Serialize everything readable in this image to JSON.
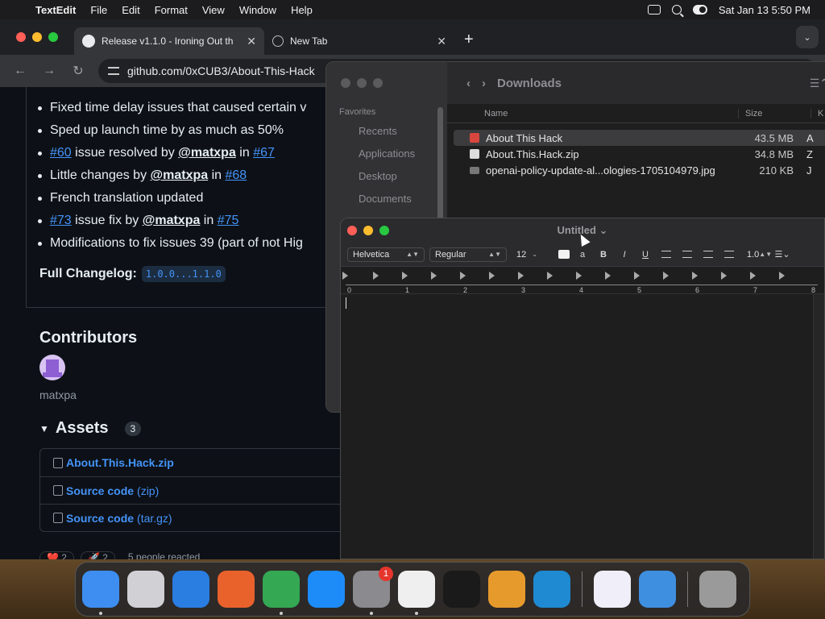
{
  "menubar": {
    "app_name": "TextEdit",
    "menus": [
      "File",
      "Edit",
      "Format",
      "View",
      "Window",
      "Help"
    ],
    "clock": "Sat Jan 13  5:50 PM"
  },
  "browser": {
    "tabs": [
      {
        "title": "Release v1.1.0 - Ironing Out th",
        "icon": "github-icon"
      },
      {
        "title": "New Tab",
        "icon": "globe-icon"
      }
    ],
    "url": "github.com/0xCUB3/About-This-Hack"
  },
  "release": {
    "bullets": [
      {
        "text": "Fixed time delay issues that caused certain v"
      },
      {
        "text": "Sped up launch time by as much as 50%"
      },
      {
        "pre": "#60",
        "mid": " issue resolved by ",
        "user": "@matxpa",
        "in": " in ",
        "post": "#67"
      },
      {
        "pre": "",
        "mid": "Little changes by ",
        "user": "@matxpa",
        "in": " in ",
        "post": "#68"
      },
      {
        "text": "French translation updated"
      },
      {
        "pre": "#73",
        "mid": " issue fix by ",
        "user": "@matxpa",
        "in": " in ",
        "post": "#75"
      },
      {
        "text": "Modifications to fix issues 39 (part of not Hig"
      }
    ],
    "changelog_label": "Full Changelog:",
    "changelog_link": "1.0.0...1.1.0",
    "contributors_title": "Contributors",
    "contributor": "matxpa",
    "assets_title": "Assets",
    "assets_count": "3",
    "assets": [
      {
        "name": "About.This.Hack.zip",
        "ext": ""
      },
      {
        "name": "Source code",
        "ext": " (zip)"
      },
      {
        "name": "Source code",
        "ext": " (tar.gz)"
      }
    ],
    "reactions": [
      "❤️ 2",
      "🚀 2",
      "5 people reacted"
    ]
  },
  "finder": {
    "title": "Downloads",
    "sidebar_header": "Favorites",
    "sidebar_items": [
      "Recents",
      "Applications",
      "Desktop",
      "Documents"
    ],
    "columns": {
      "name": "Name",
      "size": "Size",
      "kind": "K"
    },
    "files": [
      {
        "name": "About This Hack",
        "size": "43.5 MB",
        "kind": "A",
        "icon": "app"
      },
      {
        "name": "About.This.Hack.zip",
        "size": "34.8 MB",
        "kind": "Z",
        "icon": "zip"
      },
      {
        "name": "openai-policy-update-al...ologies-1705104979.jpg",
        "size": "210 KB",
        "kind": "J",
        "icon": "img"
      }
    ]
  },
  "textedit": {
    "title": "Untitled",
    "font": "Helvetica",
    "style": "Regular",
    "size": "12",
    "bold": "B",
    "italic": "I",
    "underline": "U",
    "spacing": "1.0",
    "ruler_numbers": [
      "0",
      "1",
      "2",
      "3",
      "4",
      "5",
      "6",
      "7",
      "8"
    ]
  },
  "dock": {
    "apps": [
      {
        "name": "Finder",
        "icon": "finder-icon",
        "color": "#3d8ef0",
        "running": true
      },
      {
        "name": "Launchpad",
        "icon": "launchpad-icon",
        "color": "#d0d0d5",
        "running": false
      },
      {
        "name": "Safari",
        "icon": "safari-icon",
        "color": "#2a7de1",
        "running": false
      },
      {
        "name": "Firefox",
        "icon": "firefox-icon",
        "color": "#e9622c",
        "running": false
      },
      {
        "name": "Chrome",
        "icon": "chrome-icon",
        "color": "#34a853",
        "running": true
      },
      {
        "name": "App Store",
        "icon": "app-store-icon",
        "color": "#1d8cf8",
        "running": false
      },
      {
        "name": "System Settings",
        "icon": "settings-icon",
        "color": "#8a8a8f",
        "running": true,
        "badge": "1"
      },
      {
        "name": "TextEdit",
        "icon": "textedit-icon",
        "color": "#efefef",
        "running": true
      },
      {
        "name": "Terminal",
        "icon": "terminal-icon",
        "color": "#1a1a1a",
        "running": false
      },
      {
        "name": "GarageBand",
        "icon": "garageband-icon",
        "color": "#e79a2c",
        "running": false
      },
      {
        "name": "VS Code",
        "icon": "vscode-icon",
        "color": "#1f8ad2",
        "running": false
      }
    ],
    "recent_apps": [
      {
        "name": "Visual Studio",
        "icon": "visual-studio-icon",
        "color": "#f0eef8"
      },
      {
        "name": "Weather",
        "icon": "weather-icon",
        "color": "#3f8fe0"
      }
    ],
    "trash": {
      "name": "Trash",
      "icon": "trash-icon",
      "color": "#9a9a9a"
    }
  }
}
